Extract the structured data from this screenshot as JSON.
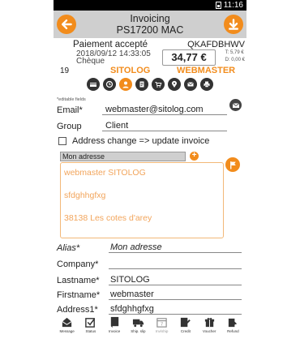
{
  "status_bar": {
    "time": "11:16"
  },
  "header": {
    "title": "Invoicing",
    "subtitle": "PS17200 MAC"
  },
  "order": {
    "status": "Paiement accepté",
    "reference": "QKAFDBHWV",
    "date": "2018/09/12 14:33:05",
    "payment": "Chèque",
    "amount": "34,77 €",
    "tax_total": "T: 5,79 €",
    "discount": "D: 0,00 €",
    "id": "19",
    "shop": "SITOLOG",
    "customer": "WEBMASTER"
  },
  "icon_bar": [
    "payment-icon",
    "history-icon",
    "customer-icon",
    "docs-icon",
    "cart-icon",
    "location-icon",
    "messages-icon",
    "print-icon"
  ],
  "form": {
    "editable_note": "*editable fields",
    "email_label": "Email*",
    "email_value": "webmaster@sitolog.com",
    "group_label": "Group",
    "group_value": "Client",
    "address_change_label": "Address change => update invoice",
    "address_select": "Mon adresse",
    "address_lines": [
      "webmaster SITOLOG",
      "sfdghhgfxg",
      "38138 Les cotes d'arey"
    ]
  },
  "details": {
    "alias_label": "Alias*",
    "alias_value": "Mon adresse",
    "company_label": "Company*",
    "company_value": "",
    "lastname_label": "Lastname*",
    "lastname_value": "SITOLOG",
    "firstname_label": "Firstname*",
    "firstname_value": "webmaster",
    "address1_label": "Address1*",
    "address1_value": "sfdghhgfxg"
  },
  "toolbar": [
    {
      "label": "Message",
      "icon": "envelope-icon"
    },
    {
      "label": "Status",
      "icon": "checkbox-icon"
    },
    {
      "label": "Invoice",
      "icon": "invoice-icon"
    },
    {
      "label": "Ship. slip",
      "icon": "truck-icon"
    },
    {
      "label": "Inv/ship",
      "icon": "calendar-icon"
    },
    {
      "label": "Credit",
      "icon": "credit-icon"
    },
    {
      "label": "Voucher",
      "icon": "voucher-icon"
    },
    {
      "label": "Refund",
      "icon": "refund-icon"
    }
  ],
  "colors": {
    "accent": "#f28c1c",
    "header_bg": "#cfcfcf"
  }
}
